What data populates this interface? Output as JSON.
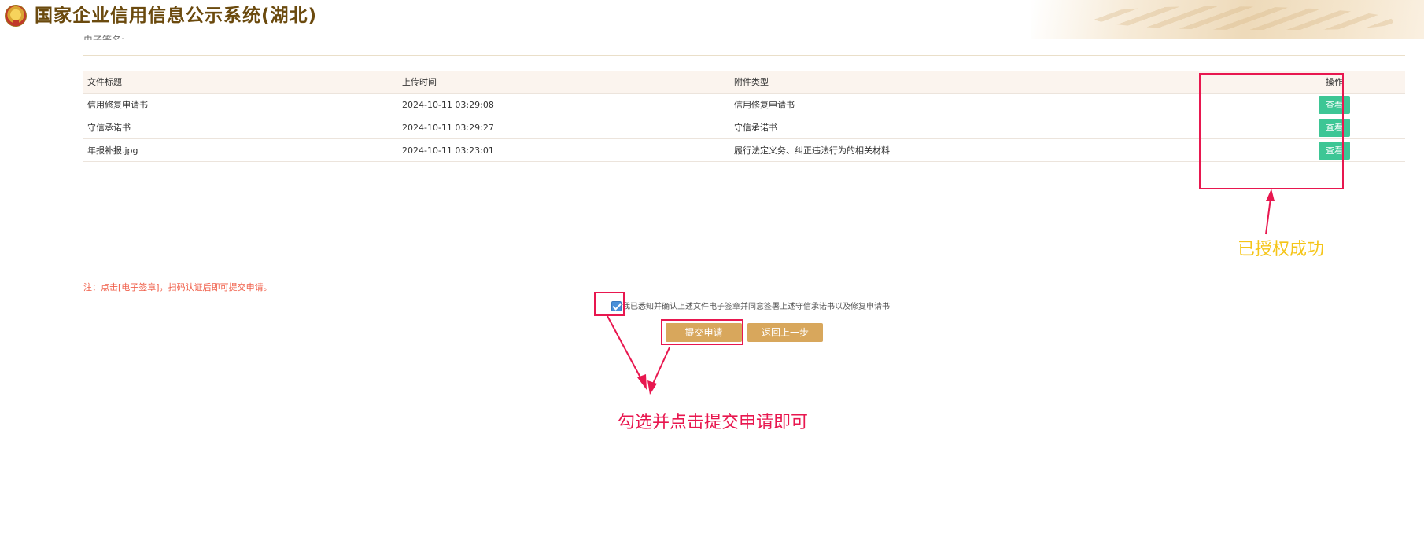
{
  "header": {
    "title": "国家企业信用信息公示系统(湖北)",
    "emblem_icon": "national-emblem-icon"
  },
  "section": {
    "label": "电子签名:"
  },
  "table": {
    "headers": [
      "文件标题",
      "上传时间",
      "附件类型",
      "操作"
    ],
    "rows": [
      {
        "title": "信用修复申请书",
        "time": "2024-10-11  03:29:08",
        "type": "信用修复申请书",
        "action": "查看"
      },
      {
        "title": "守信承诺书",
        "time": "2024-10-11  03:29:27",
        "type": "守信承诺书",
        "action": "查看"
      },
      {
        "title": "年报补报.jpg",
        "time": "2024-10-11  03:23:01",
        "type": "履行法定义务、纠正违法行为的相关材料",
        "action": "查看"
      }
    ]
  },
  "note": "注：点击[电子签章]，扫码认证后即可提交申请。",
  "agreement": {
    "checked": true,
    "text": "我已悉知并确认上述文件电子签章并同意签署上述守信承诺书以及修复申请书"
  },
  "buttons": {
    "submit": "提交申请",
    "back": "返回上一步"
  },
  "annotations": {
    "authorized": "已授权成功",
    "instruction": "勾选并点击提交申请即可"
  },
  "colors": {
    "title": "#6b4a0e",
    "view_button": "#3dc695",
    "gold_button": "#d8a75c",
    "annotation_red": "#e8174f",
    "annotation_yellow": "#f5c518",
    "note_red": "#f0604b"
  }
}
